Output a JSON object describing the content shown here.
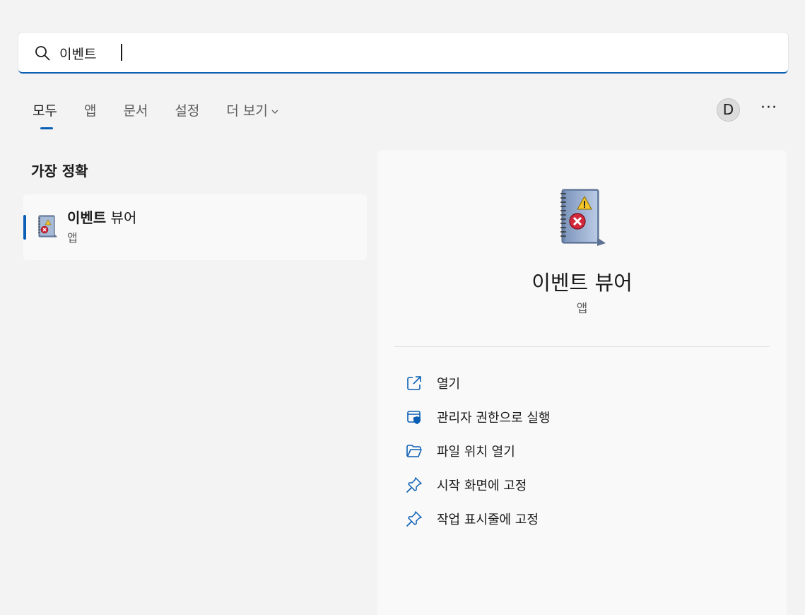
{
  "search": {
    "query": "이벤트"
  },
  "tabs": [
    {
      "label": "모두",
      "active": true
    },
    {
      "label": "앱"
    },
    {
      "label": "문서"
    },
    {
      "label": "설정"
    },
    {
      "label": "더 보기"
    }
  ],
  "header": {
    "avatar_letter": "D",
    "more_label": "···"
  },
  "best_match": {
    "section_title": "가장 정확",
    "title_bold": "이벤트",
    "title_rest": " 뷰어",
    "subtitle": "앱"
  },
  "preview": {
    "title": "이벤트 뷰어",
    "subtitle": "앱",
    "actions": [
      {
        "label": "열기",
        "icon": "open-external-icon"
      },
      {
        "label": "관리자 권한으로 실행",
        "icon": "admin-shield-icon"
      },
      {
        "label": "파일 위치 열기",
        "icon": "folder-open-icon"
      },
      {
        "label": "시작 화면에 고정",
        "icon": "pin-icon"
      },
      {
        "label": "작업 표시줄에 고정",
        "icon": "pin-icon"
      }
    ]
  },
  "colors": {
    "accent": "#0a5fb4",
    "background": "#f3f3f3",
    "card": "#f9f9f9"
  }
}
